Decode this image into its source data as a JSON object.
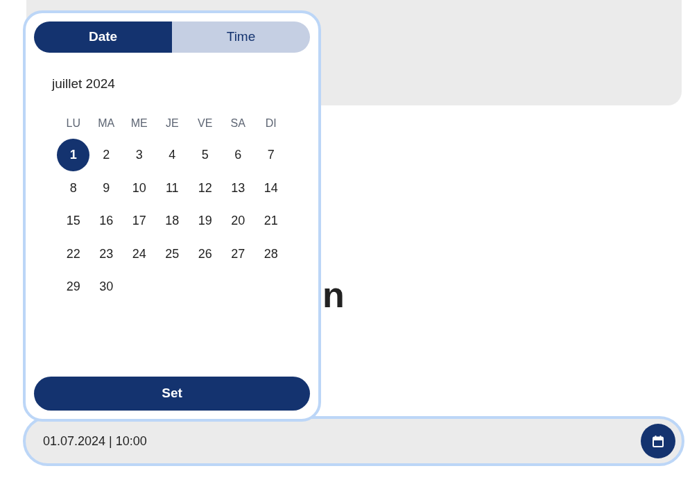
{
  "heading": {
    "text": "n"
  },
  "date_picker": {
    "tabs": [
      {
        "label": "Date",
        "selected": true
      },
      {
        "label": "Time",
        "selected": false
      }
    ],
    "month_label": "juillet 2024",
    "weekdays": [
      "LU",
      "MA",
      "ME",
      "JE",
      "VE",
      "SA",
      "DI"
    ],
    "days": [
      {
        "label": "1",
        "selected": true
      },
      {
        "label": "2",
        "selected": false
      },
      {
        "label": "3",
        "selected": false
      },
      {
        "label": "4",
        "selected": false
      },
      {
        "label": "5",
        "selected": false
      },
      {
        "label": "6",
        "selected": false
      },
      {
        "label": "7",
        "selected": false
      },
      {
        "label": "8",
        "selected": false
      },
      {
        "label": "9",
        "selected": false
      },
      {
        "label": "10",
        "selected": false
      },
      {
        "label": "11",
        "selected": false
      },
      {
        "label": "12",
        "selected": false
      },
      {
        "label": "13",
        "selected": false
      },
      {
        "label": "14",
        "selected": false
      },
      {
        "label": "15",
        "selected": false
      },
      {
        "label": "16",
        "selected": false
      },
      {
        "label": "17",
        "selected": false
      },
      {
        "label": "18",
        "selected": false
      },
      {
        "label": "19",
        "selected": false
      },
      {
        "label": "20",
        "selected": false
      },
      {
        "label": "21",
        "selected": false
      },
      {
        "label": "22",
        "selected": false
      },
      {
        "label": "23",
        "selected": false
      },
      {
        "label": "24",
        "selected": false
      },
      {
        "label": "25",
        "selected": false
      },
      {
        "label": "26",
        "selected": false
      },
      {
        "label": "27",
        "selected": false
      },
      {
        "label": "28",
        "selected": false
      },
      {
        "label": "29",
        "selected": false
      },
      {
        "label": "30",
        "selected": false
      }
    ],
    "button": "Set"
  },
  "date_field": {
    "value": "01.07.2024 | 10:00"
  }
}
